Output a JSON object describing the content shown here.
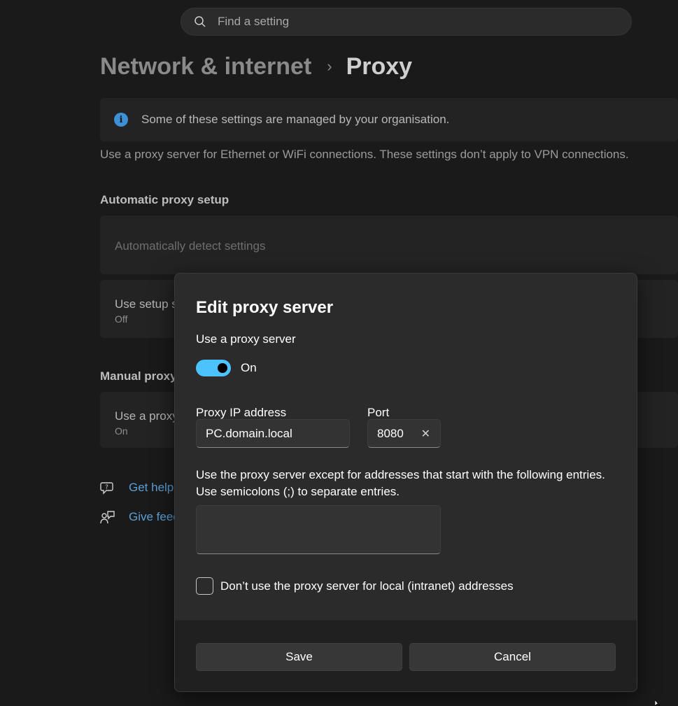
{
  "search": {
    "placeholder": "Find a setting"
  },
  "breadcrumb": {
    "parent": "Network & internet",
    "separator": "›",
    "current": "Proxy"
  },
  "banner": {
    "text": "Some of these settings are managed by your organisation."
  },
  "description": "Use a proxy server for Ethernet or WiFi connections. These settings don’t apply to VPN connections.",
  "automatic": {
    "heading": "Automatic proxy setup",
    "detect_label": "Automatically detect settings",
    "script_label": "Use setup s",
    "script_status": "Off"
  },
  "manual": {
    "heading": "Manual proxy",
    "use_label": "Use a proxy",
    "use_status": "On"
  },
  "links": {
    "help": "Get help",
    "feedback": "Give feed"
  },
  "dialog": {
    "title": "Edit proxy server",
    "use_proxy_label": "Use a proxy server",
    "toggle_state": "On",
    "ip_label": "Proxy IP address",
    "ip_value": "PC.domain.local",
    "port_label": "Port",
    "port_value": "8080",
    "exceptions_line1": "Use the proxy server except for addresses that start with the following entries.",
    "exceptions_line2": "Use semicolons (;) to separate entries.",
    "exceptions_value": "",
    "local_checkbox_label": "Don’t use the proxy server for local (intranet) addresses",
    "save_label": "Save",
    "cancel_label": "Cancel"
  },
  "colors": {
    "accent": "#4cc2ff",
    "info": "#3d8fd6",
    "link": "#5aa0d8"
  }
}
